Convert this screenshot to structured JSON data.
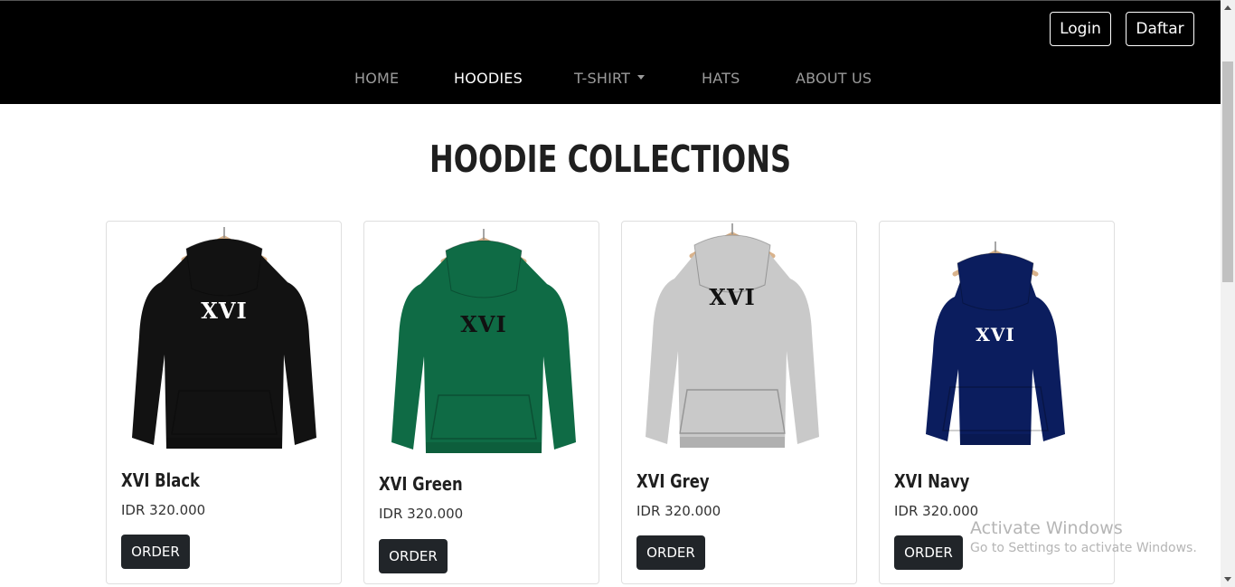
{
  "header": {
    "login_label": "Login",
    "register_label": "Daftar",
    "nav": [
      {
        "label": "HOME"
      },
      {
        "label": "HOODIES"
      },
      {
        "label": "T-SHIRT"
      },
      {
        "label": "HATS"
      },
      {
        "label": "ABOUT US"
      }
    ],
    "active_nav": "HOODIES"
  },
  "main": {
    "title": "HOODIE COLLECTIONS",
    "products": [
      {
        "name": "XVI Black",
        "price": "IDR 320.000",
        "button": "ORDER",
        "color": "#121212",
        "logo_color": "#ffffff",
        "logo": "XVI"
      },
      {
        "name": "XVI Green",
        "price": "IDR 320.000",
        "button": "ORDER",
        "color": "#0f6b45",
        "logo_color": "#111111",
        "logo": "XVI"
      },
      {
        "name": "XVI Grey",
        "price": "IDR 320.000",
        "button": "ORDER",
        "color": "#c9c9c9",
        "logo_color": "#111111",
        "logo": "XVI"
      },
      {
        "name": "XVI Navy",
        "price": "IDR 320.000",
        "button": "ORDER",
        "color": "#0b1d5e",
        "logo_color": "#ffffff",
        "logo": "XVI"
      }
    ]
  },
  "watermark": {
    "title": "Activate Windows",
    "subtitle": "Go to Settings to activate Windows."
  },
  "colors": {
    "header_bg": "#000000",
    "nav_inactive": "#9b9b9b",
    "nav_active": "#ffffff",
    "button_dark": "#212529"
  }
}
